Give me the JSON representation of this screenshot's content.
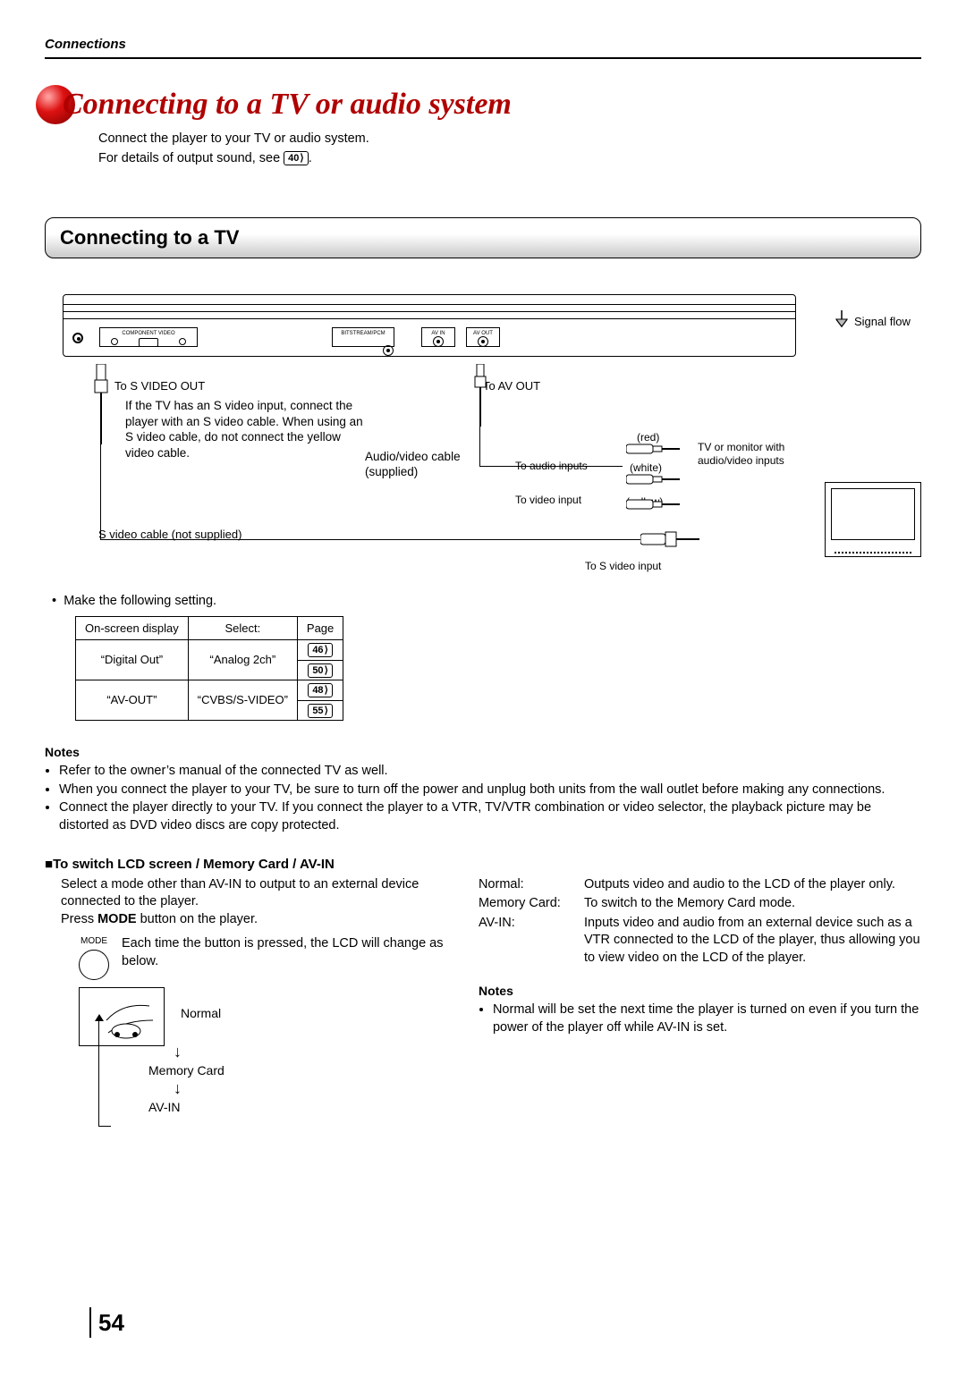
{
  "header": {
    "section": "Connections"
  },
  "title": "Connecting to a TV or audio system",
  "intro": {
    "line1": "Connect the player to your TV or audio system.",
    "line2_pre": "For details of output sound, see ",
    "line2_ref": "40",
    "line2_post": "."
  },
  "subhead": "Connecting to a TV",
  "diagram": {
    "signal_flow": "Signal flow",
    "port_component_video": "COMPONENT VIDEO",
    "port_bitstream": "BITSTREAM/PCM",
    "port_avin": "AV IN",
    "port_avout": "AV OUT",
    "to_svideo_out": "To S VIDEO OUT",
    "svideo_note": "If the TV has an S video input, connect the player with an S video cable. When using an S video cable, do not connect the yellow video cable.",
    "svideo_cable": "S video cable (not supplied)",
    "to_avout": "To AV OUT",
    "av_cable": "Audio/video cable (supplied)",
    "to_audio_inputs": "To audio inputs",
    "to_video_input": "To video input",
    "red": "(red)",
    "white": "(white)",
    "yellow": "(yellow)",
    "tv_label": "TV or monitor with audio/video inputs",
    "to_svideo_input": "To S video input"
  },
  "settings": {
    "lead": "Make the following setting.",
    "h1": "On-screen display",
    "h2": "Select:",
    "h3": "Page",
    "r1c1": "“Digital Out”",
    "r1c2": "“Analog 2ch”",
    "r1p1": "46",
    "r1p2": "50",
    "r2c1": "“AV-OUT”",
    "r2c2": "“CVBS/S-VIDEO”",
    "r2p1": "48",
    "r2p2": "55"
  },
  "notes1": {
    "head": "Notes",
    "n1": "Refer to the owner’s manual of the connected TV as well.",
    "n2": "When you connect the player to your TV, be sure to turn off the power and unplug both units from the wall outlet before making any connections.",
    "n3": "Connect the player directly to your TV.  If you connect the player to a VTR, TV/VTR combination or video selector, the playback picture may be distorted as DVD video discs are copy protected."
  },
  "switch": {
    "head": "To switch LCD screen / Memory Card / AV-IN",
    "body1": "Select a mode other than AV-IN to output to an external device connected to the player.",
    "body2_pre": "Press ",
    "body2_bold": "MODE",
    "body2_post": " button on the player.",
    "mode_caption": "MODE",
    "mode_desc": "Each time the button is pressed, the LCD will change as below.",
    "cycle_normal": "Normal",
    "cycle_memory": "Memory Card",
    "cycle_avin": "AV-IN"
  },
  "defs": {
    "k1": "Normal:",
    "v1": "Outputs video and audio to the LCD of the player only.",
    "k2": "Memory Card:",
    "v2": "To switch to the Memory Card mode.",
    "k3": "AV-IN:",
    "v3": "Inputs video and audio from an external device such as a VTR connected to the LCD of the player, thus allowing you to view video on the LCD of the player."
  },
  "notes2": {
    "head": "Notes",
    "n1": "Normal will be set the next time the player is turned on even if you turn the power of the player off while AV-IN is set."
  },
  "page_number": "54"
}
